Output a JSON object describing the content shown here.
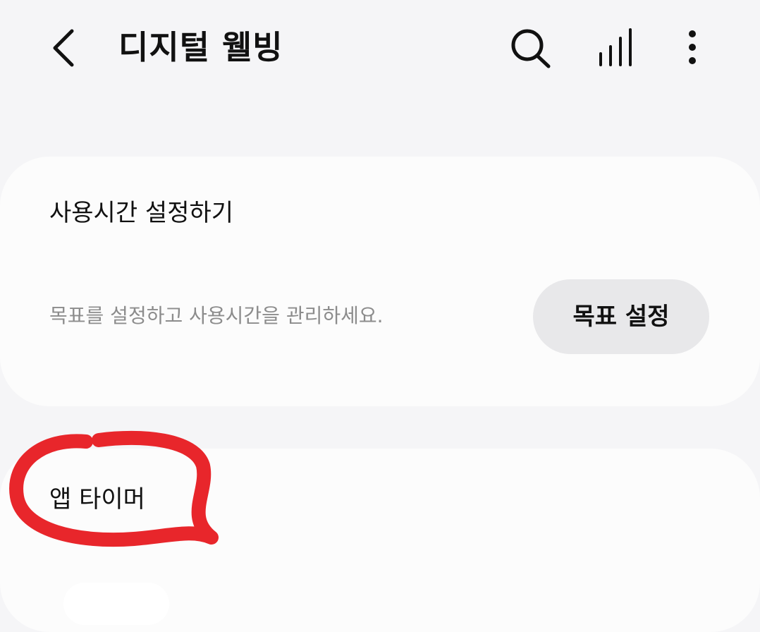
{
  "header": {
    "title": "디지털 웰빙",
    "icons": [
      "back-arrow-icon",
      "search-icon",
      "bar-chart-icon",
      "more-vert-icon"
    ]
  },
  "screen_time_card": {
    "title": "사용시간 설정하기",
    "description": "목표를 설정하고 사용시간을 관리하세요.",
    "button_label": "목표 설정"
  },
  "app_timer_card": {
    "title": "앱 타이머"
  },
  "annotation": {
    "type": "hand-drawn circle",
    "color": "#e8262b"
  },
  "colors": {
    "background": "#f5f5f7",
    "card": "#fcfcfc",
    "button": "#e8e8ea",
    "muted_text": "#8c8c8c"
  }
}
